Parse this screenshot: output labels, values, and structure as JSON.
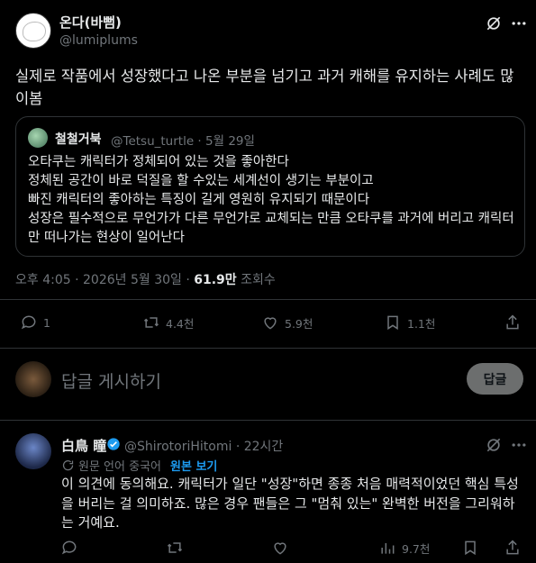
{
  "main_post": {
    "display_name": "온다(바뻠)",
    "handle": "@lumiplums",
    "text": "실제로 작품에서 성장했다고 나온 부분을 넘기고 과거 캐해를 유지하는 사례도 많이봄",
    "quote": {
      "display_name": "철철거북",
      "handle_and_date": "@Tetsu_turtle · 5월 29일",
      "text": "오타쿠는 캐릭터가 정체되어 있는 것을 좋아한다\n정체된 공간이 바로 덕질을 할 수있는 세계선이 생기는 부분이고\n빠진 캐릭터의 좋아하는 특징이 길게 영원히 유지되기 때문이다\n성장은 필수적으로 무언가가 다른 무언가로 교체되는 만큼 오타쿠를 과거에 버리고 캐릭터만 떠나가는 현상이 일어난다"
    },
    "meta": {
      "timestamp": "오후 4:05 · 2026년 5월 30일 · ",
      "views": "61.9만",
      "views_label": " 조회수"
    },
    "actions": {
      "replies": "1",
      "reposts": "4.4천",
      "likes": "5.9천",
      "bookmarks": "1.1천"
    }
  },
  "reply_box": {
    "placeholder": "답글 게시하기",
    "button": "답글"
  },
  "comment": {
    "display_name": "白鳥 瞳",
    "handle_and_time": "@ShirotoriHitomi · 22시간",
    "translate_label": "원문 언어 중국어",
    "translate_link": "원본 보기",
    "text": "이 의견에 동의해요. 캐릭터가 일단 \"성장\"하면 종종 처음 매력적이었던 핵심 특성을 버리는 걸 의미하죠. 많은 경우 팬들은 그 \"멈춰 있는\" 완벽한 버전을 그리워하는 거예요.",
    "actions": {
      "views": "9.7천"
    }
  },
  "colors": {
    "background": "#000000",
    "text": "#e7e9ea",
    "muted": "#71767b",
    "border": "#2f3336",
    "accent": "#1d9bf0"
  }
}
